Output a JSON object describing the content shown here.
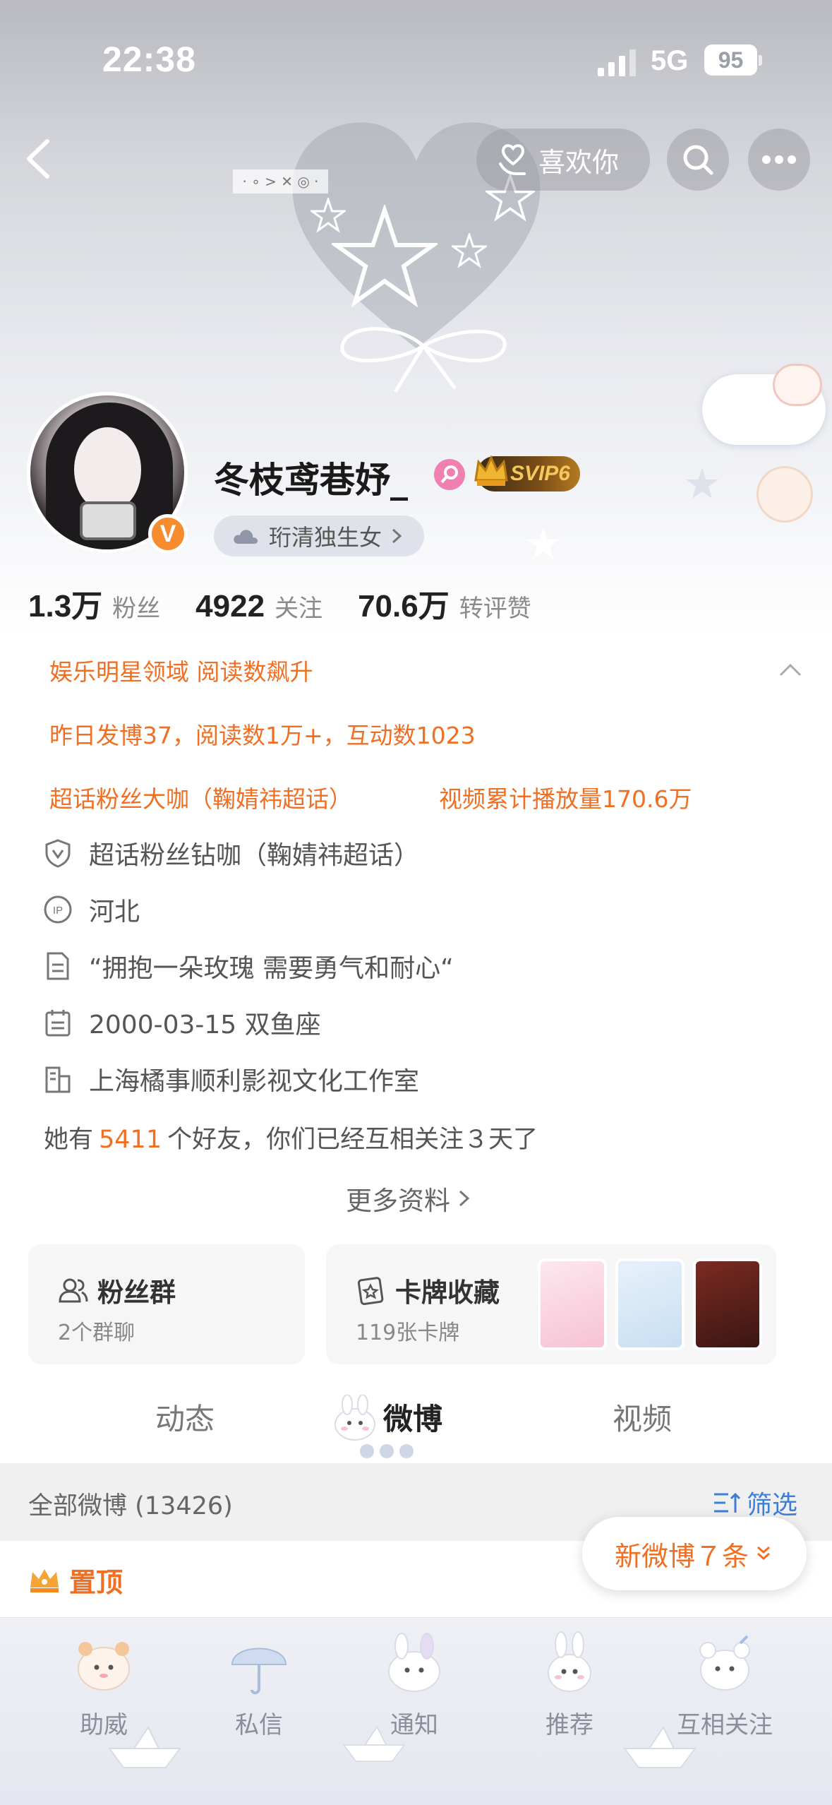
{
  "status_bar": {
    "time": "22:38",
    "network": "5G",
    "battery": "95"
  },
  "header": {
    "like_label": "喜欢你"
  },
  "profile": {
    "name": "冬枝鸢巷妤_",
    "verified_badge": "V",
    "vip_label": "SVIP6",
    "tag": "珩清独生女",
    "stats": [
      {
        "num": "1.3万",
        "label": "粉丝"
      },
      {
        "num": "4922",
        "label": "关注"
      },
      {
        "num": "70.6万",
        "label": "转评赞"
      }
    ]
  },
  "highlights": {
    "domain": "娱乐明星领域 阅读数飙升",
    "yesterday": "昨日发博37，阅读数1万+，互动数1023",
    "super_fan": "超话粉丝大咖（鞠婧祎超话）",
    "video_plays": "视频累计播放量170.6万"
  },
  "info": {
    "diamond": "超话粉丝钻咖（鞠婧祎超话）",
    "ip": "河北",
    "bio": "“拥抱一朵玫瑰 需要勇气和耐心“",
    "birthday": "2000-03-15 双鱼座",
    "company": "上海橘事顺利影视文化工作室",
    "friends_prefix": "她有",
    "friends_count": "5411",
    "friends_suffix": "个好友，你们已经互相关注３天了",
    "more": "更多资料"
  },
  "cards": {
    "fan_group": {
      "title": "粉丝群",
      "sub": "2个群聊"
    },
    "card_collection": {
      "title": "卡牌收藏",
      "sub": "119张卡牌"
    }
  },
  "tabs": [
    "动态",
    "微博",
    "视频"
  ],
  "feed": {
    "all_label": "全部微博 (13426)",
    "filter_label": "筛选",
    "pinned_label": "置顶",
    "new_posts": "新微博７条"
  },
  "bottom_nav": [
    "助威",
    "私信",
    "通知",
    "推荐",
    "互相关注"
  ],
  "colors": {
    "accent": "#f06f23",
    "link": "#3d7fd6",
    "vbadge": "#f78c2f"
  }
}
